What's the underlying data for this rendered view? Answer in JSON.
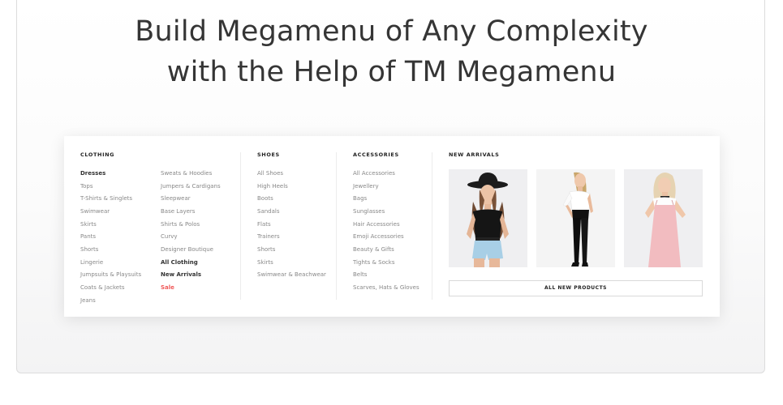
{
  "headline": {
    "line1": "Build Megamenu of Any Complexity",
    "line2": "with the Help of TM Megamenu"
  },
  "menu": {
    "clothing": {
      "title": "CLOTHING",
      "items_col1": [
        "Dresses",
        "Tops",
        "T-Shirts & Singlets",
        "Swimwear",
        "Skirts",
        "Pants",
        "Shorts",
        "Lingerie",
        "Jumpsuits & Playsuits",
        "Coats & Jackets",
        "Jeans"
      ],
      "items_col2": [
        "Sweats & Hoodies",
        "Jumpers & Cardigans",
        "Sleepwear",
        "Base Layers",
        "Shirts & Polos",
        "Curvy",
        "Designer Boutique",
        "All Clothing",
        "New Arrivals",
        "Sale"
      ]
    },
    "shoes": {
      "title": "SHOES",
      "items": [
        "All Shoes",
        "High Heels",
        "Boots",
        "Sandals",
        "Flats",
        "Trainers",
        "Shorts",
        "Skirts",
        "Swimwear & Beachwear"
      ]
    },
    "accessories": {
      "title": "ACCESSORIES",
      "items": [
        "All Accessories",
        "Jewellery",
        "Bags",
        "Sunglasses",
        "Hair Accessories",
        "Emoji Accessories",
        "Beauty & Gifts",
        "Tights & Socks",
        "Belts",
        "Scarves, Hats & Gloves"
      ]
    },
    "new_arrivals": {
      "title": "NEW ARRIVALS",
      "button_label": "ALL NEW PRODUCTS"
    }
  }
}
